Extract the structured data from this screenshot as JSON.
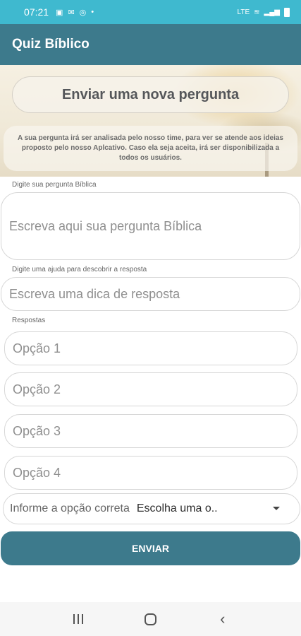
{
  "status": {
    "time": "07:21",
    "right_icons": "LTE"
  },
  "app": {
    "title": "Quiz Bíblico"
  },
  "header": {
    "title": "Enviar uma nova pergunta",
    "info": "A sua pergunta irá ser analisada pelo nosso time, para ver se atende aos ideias proposto pelo nosso Aplcativo. Caso ela seja aceita, irá ser disponibilizada a todos os usuários."
  },
  "form": {
    "question_label": "Digite sua pergunta Bíblica",
    "question_placeholder": "Escreva aqui sua pergunta Bíblica",
    "hint_label": "Digite uma ajuda para descobrir a resposta",
    "hint_placeholder": "Escreva uma dica de resposta",
    "answers_label": "Respostas",
    "options": [
      "Opção 1",
      "Opção 2",
      "Opção 3",
      "Opção 4"
    ],
    "correct_label": "Informe a opção correta",
    "correct_value": "Escolha uma o..",
    "submit_label": "ENVIAR"
  },
  "colors": {
    "status_bar": "#3fb9cf",
    "primary": "#3d7a8c"
  }
}
